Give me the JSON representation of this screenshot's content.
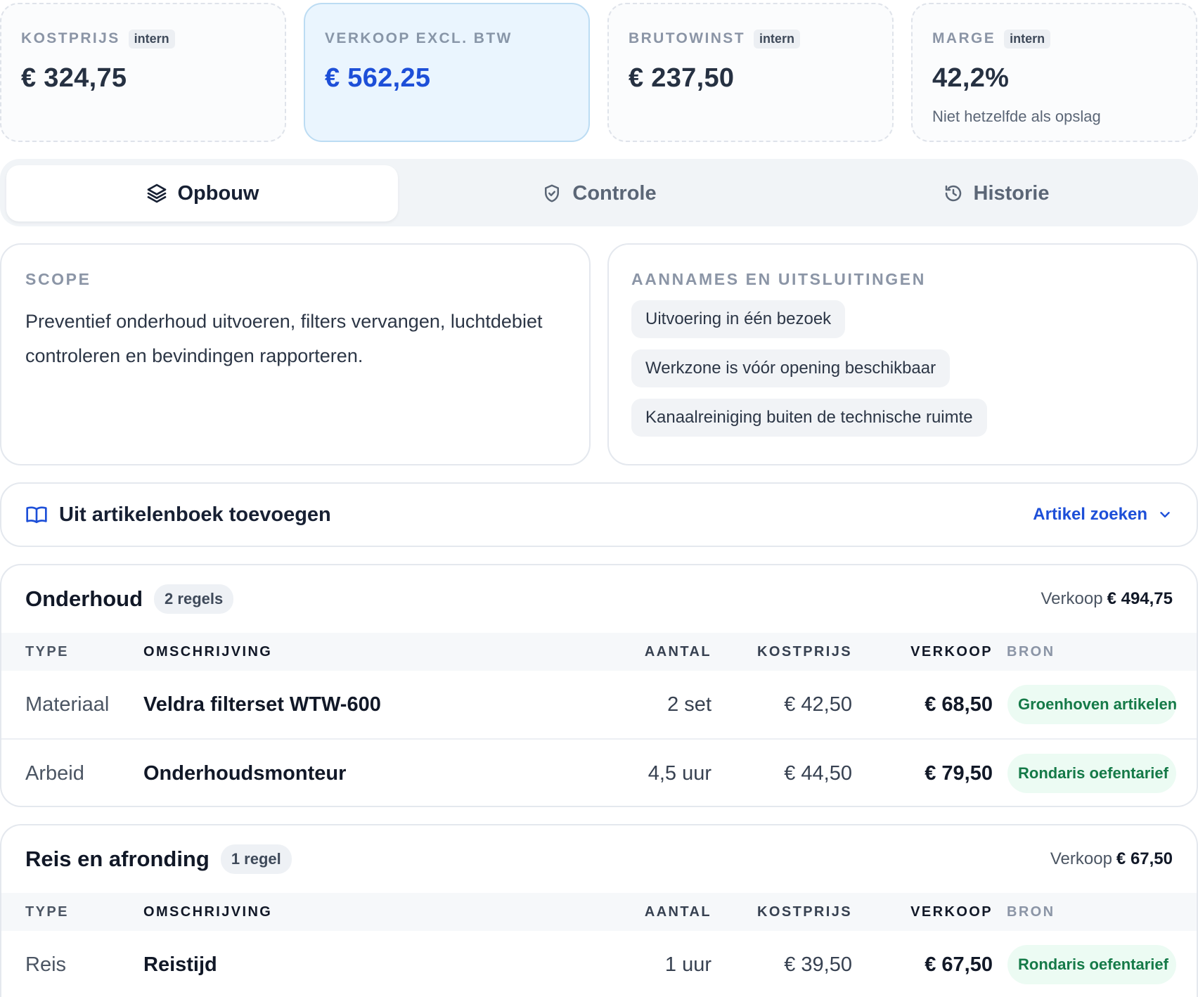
{
  "kpis": [
    {
      "label": "KOSTPRIJS",
      "badge": "intern",
      "value": "€ 324,75"
    },
    {
      "label": "VERKOOP EXCL. BTW",
      "value": "€ 562,25"
    },
    {
      "label": "BRUTOWINST",
      "badge": "intern",
      "value": "€ 237,50"
    },
    {
      "label": "MARGE",
      "badge": "intern",
      "value": "42,2%",
      "note": "Niet hetzelfde als opslag"
    }
  ],
  "tabs": [
    {
      "label": "Opbouw",
      "icon": "layers-icon",
      "active": true
    },
    {
      "label": "Controle",
      "icon": "shield-check-icon",
      "active": false
    },
    {
      "label": "Historie",
      "icon": "history-icon",
      "active": false
    }
  ],
  "scope": {
    "label": "SCOPE",
    "text": "Preventief onderhoud uitvoeren, filters vervangen, luchtdebiet controleren en bevindingen rapporteren."
  },
  "assumptions": {
    "label": "AANNAMES EN UITSLUITINGEN",
    "items": [
      "Uitvoering in één bezoek",
      "Werkzone is vóór opening beschikbaar",
      "Kanaalreiniging buiten de technische ruimte"
    ]
  },
  "article_book": {
    "title": "Uit artikelenboek toevoegen",
    "icon": "book-open-icon",
    "search_label": "Artikel zoeken"
  },
  "table_headers": {
    "type": "TYPE",
    "description": "OMSCHRIJVING",
    "quantity": "AANTAL",
    "cost": "KOSTPRIJS",
    "sale": "VERKOOP",
    "source": "BRON"
  },
  "groups": [
    {
      "title": "Onderhoud",
      "count": "2 regels",
      "total_label": "Verkoop",
      "total_value": "€ 494,75",
      "rows": [
        {
          "type": "Materiaal",
          "description": "Veldra filterset WTW-600",
          "quantity": "2 set",
          "cost": "€ 42,50",
          "sale": "€ 68,50",
          "source": "Groenhoven artikelen"
        },
        {
          "type": "Arbeid",
          "description": "Onderhoudsmonteur",
          "quantity": "4,5 uur",
          "cost": "€ 44,50",
          "sale": "€ 79,50",
          "source": "Rondaris oefentarief"
        }
      ]
    },
    {
      "title": "Reis en afronding",
      "count": "1 regel",
      "total_label": "Verkoop",
      "total_value": "€ 67,50",
      "rows": [
        {
          "type": "Reis",
          "description": "Reistijd",
          "quantity": "1 uur",
          "cost": "€ 39,50",
          "sale": "€ 67,50",
          "source": "Rondaris oefentarief"
        }
      ]
    }
  ],
  "colors": {
    "accent": "#1d4fd8",
    "source_badge_bg": "#ecfbf3",
    "source_badge_text": "#157a48"
  }
}
